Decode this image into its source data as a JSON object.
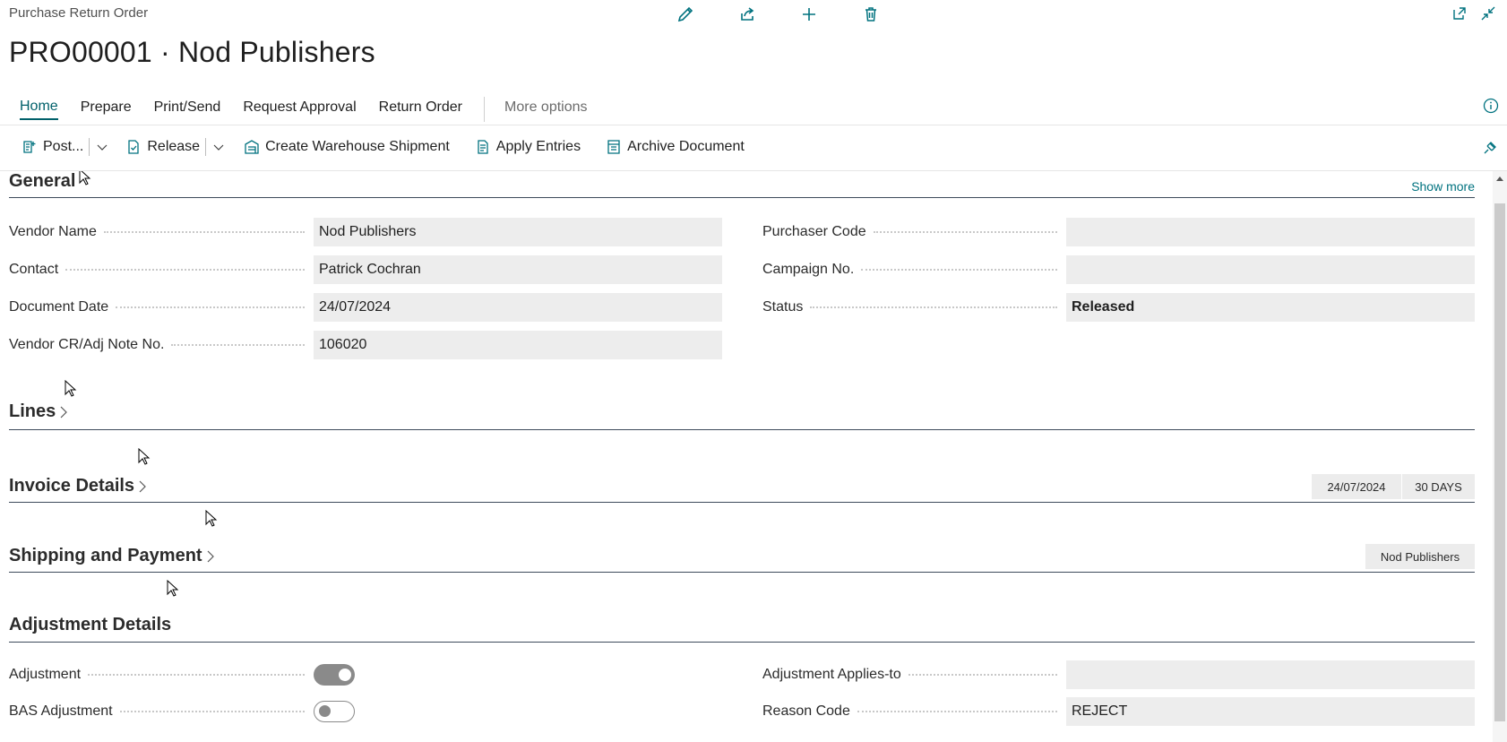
{
  "header": {
    "caption": "Purchase Return Order",
    "title": "PRO00001 · Nod Publishers",
    "icons": [
      "edit-icon",
      "share-icon",
      "add-icon",
      "delete-icon",
      "open-new-window-icon",
      "collapse-icon"
    ]
  },
  "tabs": [
    {
      "label": "Home",
      "active": true
    },
    {
      "label": "Prepare"
    },
    {
      "label": "Print/Send"
    },
    {
      "label": "Request Approval"
    },
    {
      "label": "Return Order"
    },
    {
      "label": "More options"
    }
  ],
  "actions": {
    "post": "Post...",
    "release": "Release",
    "create_warehouse_shipment": "Create Warehouse Shipment",
    "apply_entries": "Apply Entries",
    "archive_document": "Archive Document"
  },
  "general": {
    "title": "General",
    "show_more": "Show more",
    "left": [
      {
        "label": "Vendor Name",
        "value": "Nod Publishers"
      },
      {
        "label": "Contact",
        "value": "Patrick Cochran"
      },
      {
        "label": "Document Date",
        "value": "24/07/2024"
      },
      {
        "label": "Vendor CR/Adj Note No.",
        "value": "106020"
      }
    ],
    "right": [
      {
        "label": "Purchaser Code",
        "value": ""
      },
      {
        "label": "Campaign No.",
        "value": ""
      },
      {
        "label": "Status",
        "value": "Released"
      }
    ]
  },
  "lines": {
    "title": "Lines"
  },
  "invoice_details": {
    "title": "Invoice Details",
    "badges": [
      "24/07/2024",
      "30 DAYS"
    ]
  },
  "shipping_payment": {
    "title": "Shipping and Payment",
    "badges": [
      "Nod Publishers"
    ]
  },
  "adjustment_details": {
    "title": "Adjustment Details",
    "left": [
      {
        "label": "Adjustment",
        "value": true
      },
      {
        "label": "BAS Adjustment",
        "value": false
      }
    ],
    "right": [
      {
        "label": "Adjustment Applies-to",
        "value": ""
      },
      {
        "label": "Reason Code",
        "value": "REJECT"
      }
    ]
  },
  "colors": {
    "accent": "#00606a",
    "link": "#00727f",
    "field_bg": "#ededed"
  }
}
